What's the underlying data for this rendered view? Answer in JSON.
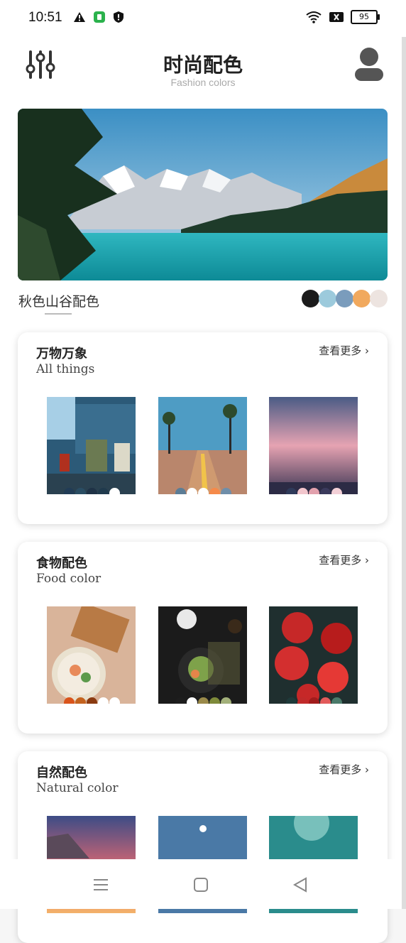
{
  "status": {
    "time": "10:51",
    "battery": "95",
    "icons_left": [
      "warning-icon",
      "app-badge-icon",
      "shield-icon"
    ],
    "icons_right": [
      "wifi-icon",
      "sim-x-icon",
      "battery-icon"
    ]
  },
  "header": {
    "title": "时尚配色",
    "subtitle": "Fashion colors",
    "left_icon": "sliders-icon",
    "right_icon": "user-icon"
  },
  "hero": {
    "caption": "秋色山谷配色",
    "colors": [
      "#1b1b1b",
      "#9ccadc",
      "#7a9cbc",
      "#f1a95e",
      "#ede4e0"
    ]
  },
  "sections": [
    {
      "title": "万物万象",
      "subtitle": "All things",
      "more": "查看更多",
      "thumbs": [
        {
          "colors": [
            "#213c56",
            "#2a4d63",
            "#1f3246",
            "#203a4d",
            "#ffffff"
          ]
        },
        {
          "colors": [
            "#5c7d96",
            "#ffffff",
            "#ffffff",
            "#f58a4a",
            "#6f8ea9"
          ]
        },
        {
          "colors": [
            "#2f3a5a",
            "#f2c6cd",
            "#e2a1ad",
            "#3b3a5c",
            "#f3d0d7"
          ]
        }
      ]
    },
    {
      "title": "食物配色",
      "subtitle": "Food color",
      "more": "查看更多",
      "thumbs": [
        {
          "colors": [
            "#d9541b",
            "#c4631f",
            "#8a3a10",
            "#ffffff",
            "#ffffff"
          ]
        },
        {
          "colors": [
            "#1d1d1d",
            "#ffffff",
            "#9a8a4a",
            "#7e8a3a",
            "#a3b07a"
          ]
        },
        {
          "colors": [
            "#1e3a3a",
            "#c02a2a",
            "#a11c1c",
            "#e25a5a",
            "#4a7a6a"
          ]
        }
      ]
    },
    {
      "title": "自然配色",
      "subtitle": "Natural color",
      "more": "查看更多",
      "thumbs": []
    }
  ],
  "nav": {
    "menu_icon": "menu-icon",
    "home_icon": "home-square-icon",
    "back_icon": "back-triangle-icon"
  }
}
